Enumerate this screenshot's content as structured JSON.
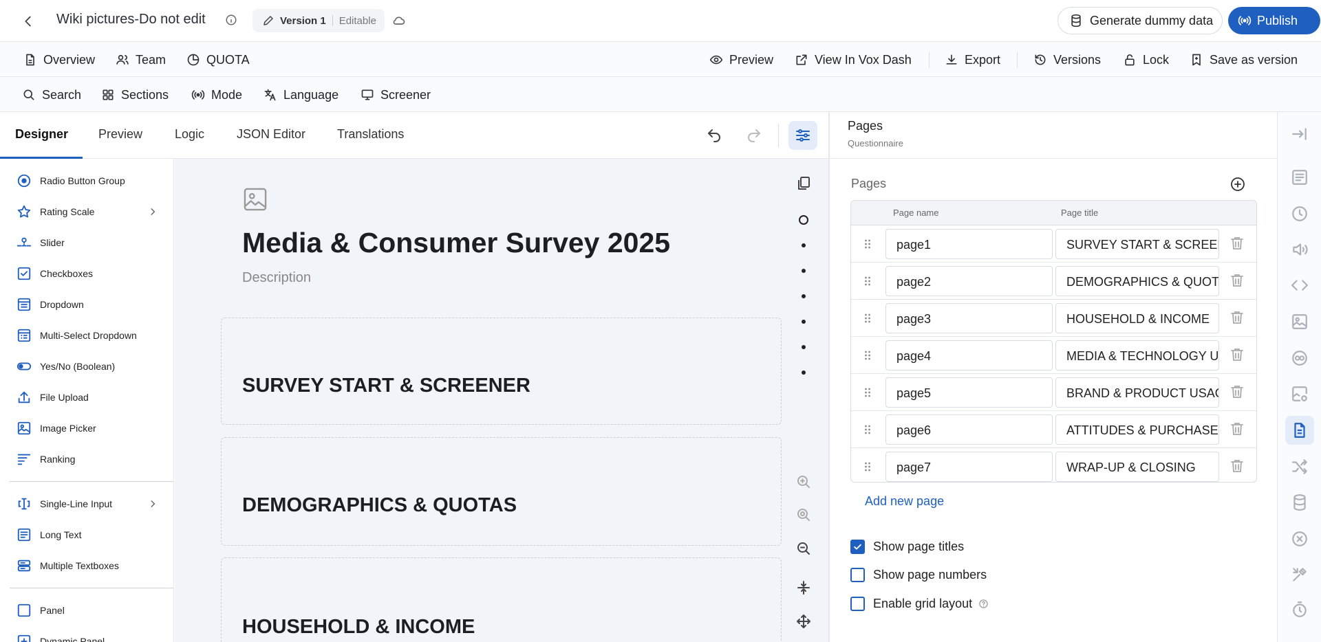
{
  "header": {
    "doc_title": "Wiki pictures-Do not edit",
    "version_name": "Version 1",
    "version_state": "Editable",
    "generate_label": "Generate dummy data",
    "publish_label": "Publish"
  },
  "nav": {
    "left": [
      {
        "label": "Overview",
        "icon": "file-icon"
      },
      {
        "label": "Team",
        "icon": "users-icon"
      },
      {
        "label": "QUOTA",
        "icon": "pie-chart-icon"
      }
    ],
    "right": [
      {
        "label": "Preview",
        "icon": "eye-icon"
      },
      {
        "label": "View In Vox Dash",
        "icon": "external-link-icon"
      },
      {
        "label": "Export",
        "icon": "download-icon"
      },
      {
        "label": "Versions",
        "icon": "history-icon"
      },
      {
        "label": "Lock",
        "icon": "lock-icon"
      },
      {
        "label": "Save as version",
        "icon": "bookmark-icon"
      }
    ]
  },
  "toolbar": {
    "items": [
      {
        "label": "Search",
        "icon": "search-icon"
      },
      {
        "label": "Sections",
        "icon": "grid-icon"
      },
      {
        "label": "Mode",
        "icon": "broadcast-icon"
      },
      {
        "label": "Language",
        "icon": "translate-icon"
      },
      {
        "label": "Screener",
        "icon": "monitor-icon"
      }
    ]
  },
  "tabs": [
    "Designer",
    "Preview",
    "Logic",
    "JSON Editor",
    "Translations"
  ],
  "toolbox": {
    "group1": [
      "Radio Button Group",
      "Rating Scale",
      "Slider",
      "Checkboxes",
      "Dropdown",
      "Multi-Select Dropdown",
      "Yes/No (Boolean)",
      "File Upload",
      "Image Picker",
      "Ranking"
    ],
    "group2": [
      "Single-Line Input",
      "Long Text",
      "Multiple Textboxes"
    ],
    "group3": [
      "Panel",
      "Dynamic Panel"
    ]
  },
  "survey": {
    "title": "Media & Consumer Survey 2025",
    "description": "Description",
    "pages": [
      "SURVEY START & SCREENER",
      "DEMOGRAPHICS & QUOTAS",
      "HOUSEHOLD & INCOME"
    ]
  },
  "right_panel": {
    "title": "Pages",
    "subtitle": "Questionnaire",
    "section_title": "Pages",
    "col_name": "Page name",
    "col_title": "Page title",
    "rows": [
      {
        "name": "page1",
        "title": "SURVEY START & SCREENER"
      },
      {
        "name": "page2",
        "title": "DEMOGRAPHICS & QUOTAS"
      },
      {
        "name": "page3",
        "title": "HOUSEHOLD & INCOME"
      },
      {
        "name": "page4",
        "title": "MEDIA & TECHNOLOGY USAGE"
      },
      {
        "name": "page5",
        "title": "BRAND & PRODUCT USAGE"
      },
      {
        "name": "page6",
        "title": "ATTITUDES & PURCHASE"
      },
      {
        "name": "page7",
        "title": "WRAP-UP & CLOSING"
      }
    ],
    "add_new_page": "Add new page",
    "options": [
      {
        "label": "Show page titles",
        "checked": true
      },
      {
        "label": "Show page numbers",
        "checked": false
      },
      {
        "label": "Enable grid layout",
        "checked": false
      }
    ]
  },
  "colors": {
    "accent": "#1f5fbf",
    "accent_bg": "#e3ecf8",
    "canvas_bg": "#f1f4f8"
  }
}
